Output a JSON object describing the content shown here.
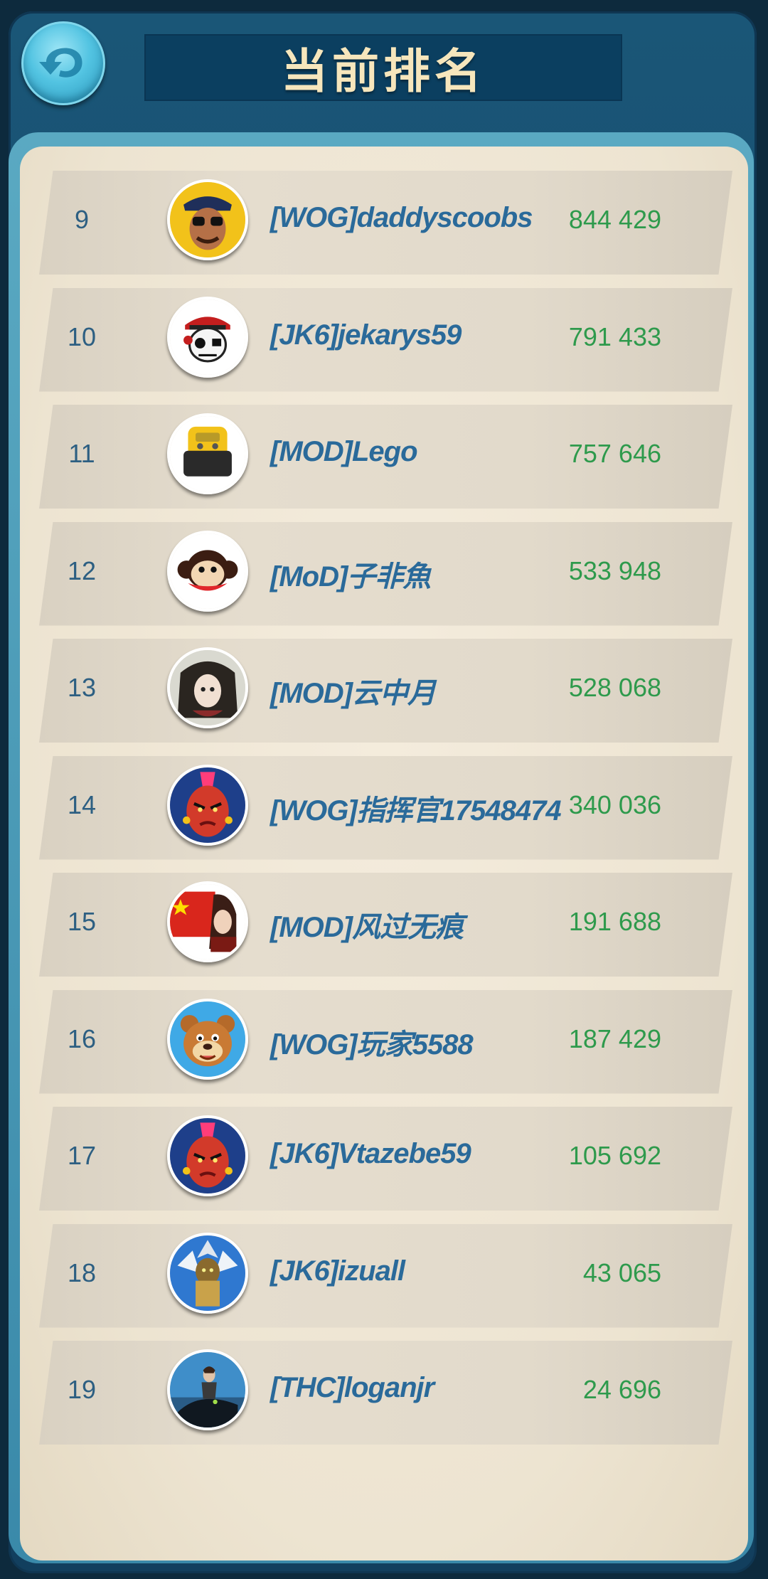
{
  "header": {
    "title": "当前排名",
    "back_icon": "back-arrow-icon"
  },
  "leaderboard": [
    {
      "rank": "9",
      "name": "[WOG]daddyscoobs",
      "score": "844 429",
      "avatar": "cowboy-sunglasses"
    },
    {
      "rank": "10",
      "name": "[JK6]jekarys59",
      "score": "791 433",
      "avatar": "pirate-skull"
    },
    {
      "rank": "11",
      "name": "[MOD]Lego",
      "score": "757 646",
      "avatar": "lego-head"
    },
    {
      "rank": "12",
      "name": "[MoD]子非魚",
      "score": "533 948",
      "avatar": "monkey"
    },
    {
      "rank": "13",
      "name": "[MOD]云中月",
      "score": "528 068",
      "avatar": "anime-girl"
    },
    {
      "rank": "14",
      "name": "[WOG]指挥官17548474",
      "score": "340 036",
      "avatar": "red-warrior"
    },
    {
      "rank": "15",
      "name": "[MOD]风过无痕",
      "score": "191 688",
      "avatar": "flag-character"
    },
    {
      "rank": "16",
      "name": "[WOG]玩家5588",
      "score": "187 429",
      "avatar": "cartoon-bear"
    },
    {
      "rank": "17",
      "name": "[JK6]Vtazebe59",
      "score": "105 692",
      "avatar": "red-warrior"
    },
    {
      "rank": "18",
      "name": "[JK6]izuall",
      "score": "43 065",
      "avatar": "armored-knight"
    },
    {
      "rank": "19",
      "name": "[THC]loganjr",
      "score": "24 696",
      "avatar": "dragon-rider"
    }
  ],
  "colors": {
    "rank": "#2d5f82",
    "name": "#2a6a9a",
    "score": "#2e9a4c",
    "title": "#f6e6bc"
  }
}
